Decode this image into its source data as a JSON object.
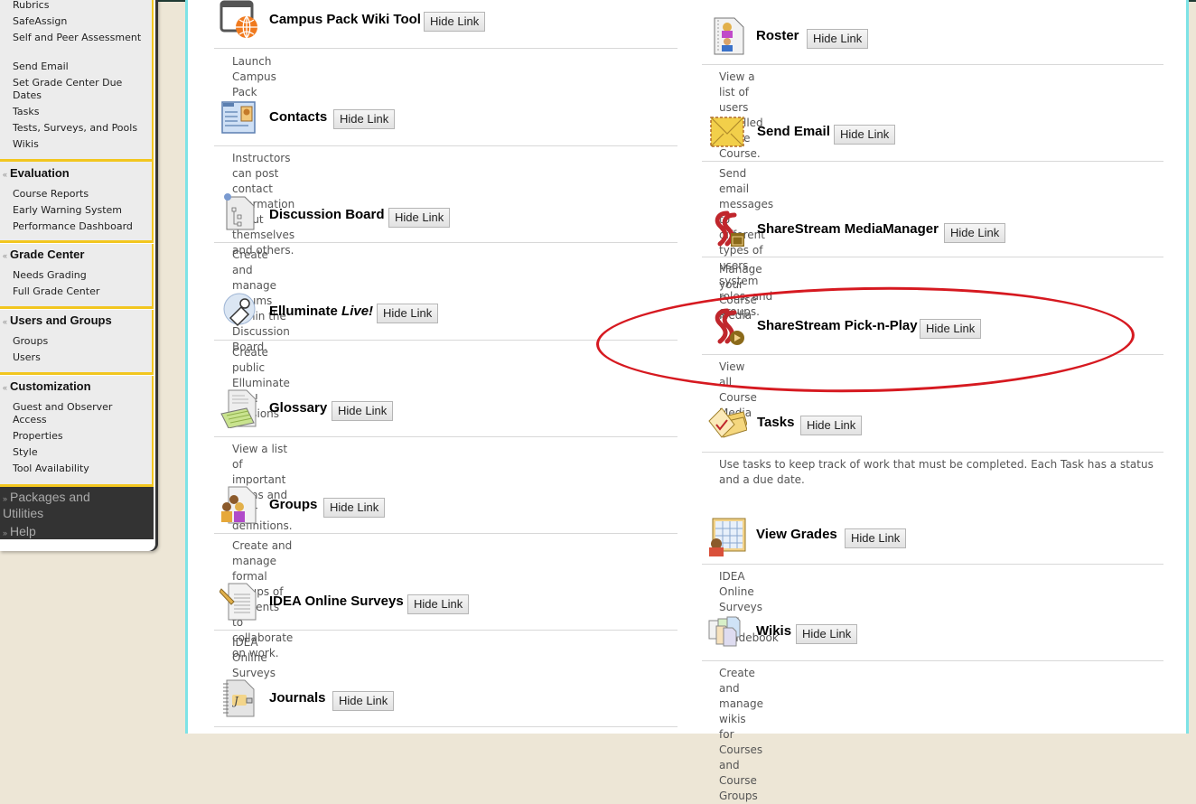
{
  "sidebar": {
    "tools_items": [
      "Rubrics",
      "SafeAssign",
      "Self and Peer Assessment",
      "Send Email",
      "Set Grade Center Due Dates",
      "Tasks",
      "Tests, Surveys, and Pools",
      "Wikis"
    ],
    "sections": [
      {
        "title": "Evaluation",
        "items": [
          "Course Reports",
          "Early Warning System",
          "Performance Dashboard"
        ]
      },
      {
        "title": "Grade Center",
        "items": [
          "Needs Grading",
          "Full Grade Center"
        ]
      },
      {
        "title": "Users and Groups",
        "items": [
          "Groups",
          "Users"
        ]
      },
      {
        "title": "Customization",
        "items": [
          "Guest and Observer Access",
          "Properties",
          "Style",
          "Tool Availability"
        ]
      }
    ],
    "collapsed": [
      {
        "title": "Packages and Utilities"
      },
      {
        "title": "Help"
      }
    ],
    "expand_glyph": "«",
    "collapse_glyph": "»"
  },
  "hide_link_label": "Hide Link",
  "tools_left": [
    {
      "title": "Campus Pack Wiki Tool",
      "desc": "Launch Campus Pack Wiki Tool",
      "icon": "campus-pack-wiki-icon"
    },
    {
      "title": "Contacts",
      "desc": "Instructors can post contact information about themselves and others.",
      "icon": "contacts-icon"
    },
    {
      "title": "Discussion Board",
      "desc": "Create and manage Forums within the Discussion Board.",
      "icon": "discussion-board-icon"
    },
    {
      "title": "Elluminate",
      "title_italic": "Live!",
      "desc": "Create public Elluminate Live! Sessions",
      "icon": "elluminate-icon"
    },
    {
      "title": "Glossary",
      "desc": "View a list of important terms and their definitions.",
      "icon": "glossary-icon"
    },
    {
      "title": "Groups",
      "desc": "Create and manage formal groups of students to collaborate on work.",
      "icon": "groups-icon"
    },
    {
      "title": "IDEA Online Surveys",
      "desc": "IDEA Online Surveys",
      "icon": "idea-surveys-icon"
    },
    {
      "title": "Journals",
      "desc": "",
      "icon": "journals-icon"
    }
  ],
  "tools_right": [
    {
      "title": "Roster",
      "desc": "View a list of users enrolled in the Course.",
      "icon": "roster-icon"
    },
    {
      "title": "Send Email",
      "desc": "Send email messages to different types of users, system roles, and groups.",
      "icon": "send-email-icon"
    },
    {
      "title": "ShareStream MediaManager",
      "desc": "Manage your Course Media",
      "icon": "sharestream-mediamanager-icon"
    },
    {
      "title": "ShareStream Pick-n-Play",
      "desc": "View all Course Media",
      "icon": "sharestream-pick-n-play-icon",
      "highlighted": true
    },
    {
      "title": "Tasks",
      "desc": "Use tasks to keep track of work that must be completed. Each Task has a status and a due date.",
      "icon": "tasks-icon"
    },
    {
      "title": "View Grades",
      "desc": "IDEA Online Surveys and Gradebook",
      "icon": "view-grades-icon"
    },
    {
      "title": "Wikis",
      "desc": "Create and manage wikis for Courses and Course Groups",
      "icon": "wikis-icon"
    }
  ],
  "colors": {
    "accent_yellow": "#f2c61f",
    "frame_cyan": "#7ee3e6",
    "highlight_red": "#d61920",
    "sidebar_dark": "#333333"
  }
}
